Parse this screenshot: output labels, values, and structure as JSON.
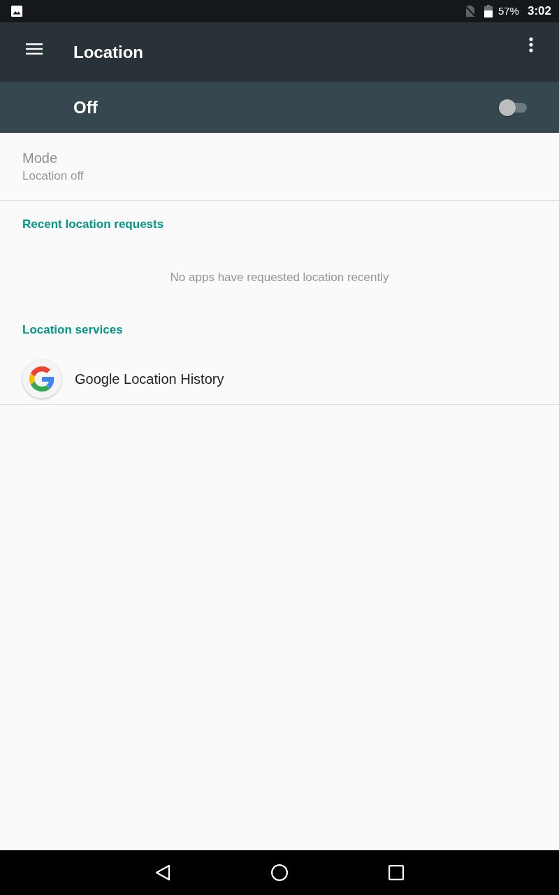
{
  "status_bar": {
    "battery": "57%",
    "time": "3:02"
  },
  "app_bar": {
    "title": "Location"
  },
  "master_switch": {
    "label": "Off",
    "on": false
  },
  "mode": {
    "title": "Mode",
    "summary": "Location off",
    "disabled": true
  },
  "sections": [
    {
      "kind": "requests",
      "header": "Recent location requests",
      "empty_text": "No apps have requested location recently"
    },
    {
      "kind": "services",
      "header": "Location services",
      "items": [
        {
          "label": "Google Location History"
        }
      ]
    }
  ]
}
